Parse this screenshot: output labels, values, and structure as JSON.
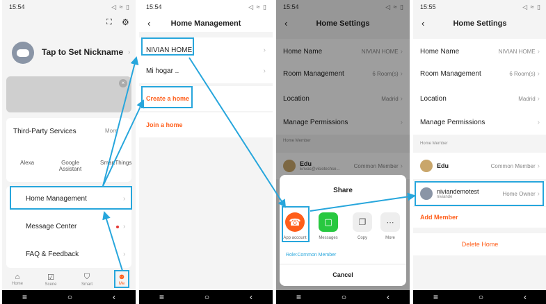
{
  "colors": {
    "accent": "#27a6dc",
    "orange": "#ff5e1a"
  },
  "statusbar": [
    {
      "time": "15:54",
      "right": "◁ ≈ ▯"
    },
    {
      "time": "15:54",
      "right": "◁ ≈ ▯"
    },
    {
      "time": "15:54",
      "right": "◁ ≈ ▯"
    },
    {
      "time": "15:55",
      "right": "◁ ≈ ▯"
    }
  ],
  "navbar": {
    "menu": "≡",
    "home": "○",
    "back": "‹"
  },
  "me": {
    "nickname": "Tap to Set Nickname",
    "third_party": {
      "label": "Third-Party Services",
      "more": "More"
    },
    "services": [
      "Alexa",
      "Google Assistant",
      "SmartThings"
    ],
    "menu": [
      "Home Management",
      "Message Center",
      "FAQ & Feedback"
    ],
    "tabs": [
      "Home",
      "Scene",
      "Smart",
      "Me"
    ]
  },
  "home_mgmt": {
    "title": "Home Management",
    "homes": [
      "NIVIAN HOME",
      "Mi hogar .."
    ],
    "create": "Create a home",
    "join": "Join a home"
  },
  "settings": {
    "title": "Home Settings",
    "rows": [
      {
        "label": "Home Name",
        "value": "NIVIAN HOME"
      },
      {
        "label": "Room Management",
        "value": "6 Room(s)"
      },
      {
        "label": "Location",
        "value": "Madrid"
      },
      {
        "label": "Manage Permissions",
        "value": ""
      }
    ],
    "member_header": "Home Member",
    "member": {
      "name": "Edu",
      "email": "Erivas@visiotechse...",
      "role": "Common Member"
    },
    "share": {
      "title": "Share",
      "options": [
        "App account",
        "Messages",
        "Copy",
        "More"
      ],
      "role": "Role:Common Member",
      "cancel": "Cancel"
    }
  },
  "settings2": {
    "title": "Home Settings",
    "rows": [
      {
        "label": "Home Name",
        "value": "NIVIAN HOME"
      },
      {
        "label": "Room Management",
        "value": "6 Room(s)"
      },
      {
        "label": "Location",
        "value": "Madrid"
      },
      {
        "label": "Manage Permissions",
        "value": ""
      }
    ],
    "member_header": "Home Member",
    "members": [
      {
        "name": "Edu",
        "role": "Common Member"
      },
      {
        "name": "niviandemotest",
        "sub": "niviande",
        "role": "Home Owner"
      }
    ],
    "add_member": "Add Member",
    "delete": "Delete Home"
  }
}
